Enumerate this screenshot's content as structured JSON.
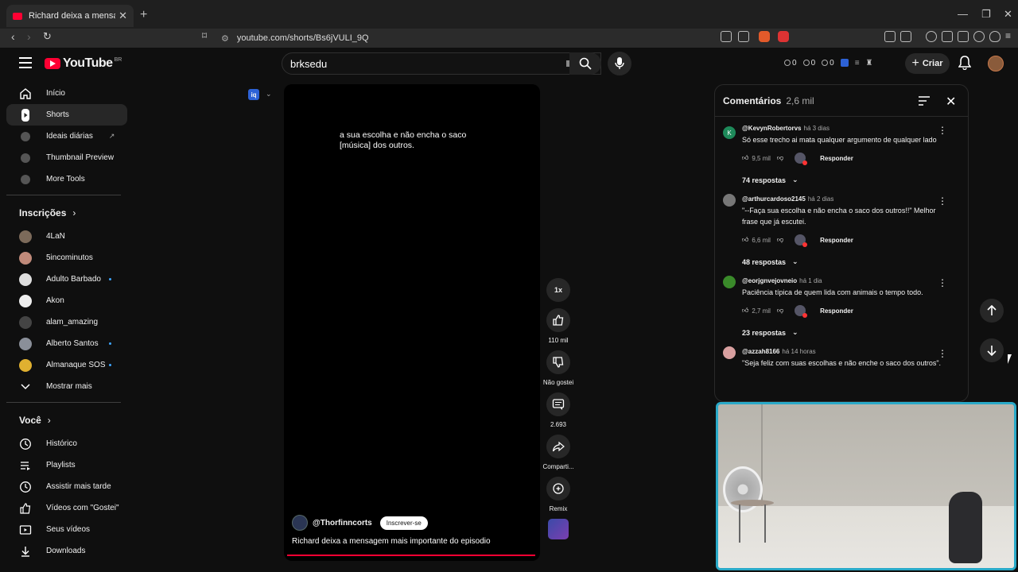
{
  "browser": {
    "tab_title": "Richard deixa a mensagem mais",
    "url": "youtube.com/shorts/Bs6jVULI_9Q"
  },
  "masthead": {
    "logo_text": "YouTube",
    "country_code": "BR",
    "search_value": "brksedu",
    "stats": [
      "0",
      "0",
      "0"
    ],
    "create_label": "Criar"
  },
  "sidebar": {
    "main": [
      {
        "label": "Início",
        "icon": "home-icon"
      },
      {
        "label": "Shorts",
        "icon": "shorts-icon"
      },
      {
        "label": "Ideais diárias",
        "icon": "ideas-icon"
      },
      {
        "label": "Thumbnail Preview",
        "icon": "thumbnail-icon"
      },
      {
        "label": "More Tools",
        "icon": "tools-icon"
      }
    ],
    "subscriptions_header": "Inscrições",
    "subscriptions": [
      {
        "label": "4LaN",
        "color": "#7c6a5a"
      },
      {
        "label": "5incominutos",
        "color": "#c08a7a"
      },
      {
        "label": "Adulto Barbado",
        "color": "#dddddd"
      },
      {
        "label": "Akon",
        "color": "#eeeeee"
      },
      {
        "label": "alam_amazing",
        "color": "#2a2a2a"
      },
      {
        "label": "Alberto Santos",
        "color": "#8a8f99"
      },
      {
        "label": "Almanaque SOS",
        "color": "#e0b030"
      }
    ],
    "show_more": "Mostrar mais",
    "you_header": "Você",
    "you_items": [
      {
        "label": "Histórico",
        "icon": "history-icon"
      },
      {
        "label": "Playlists",
        "icon": "playlists-icon"
      },
      {
        "label": "Assistir mais tarde",
        "icon": "watch-later-icon"
      },
      {
        "label": "Vídeos com \"Gostei\"",
        "icon": "like-icon"
      },
      {
        "label": "Seus vídeos",
        "icon": "your-videos-icon"
      },
      {
        "label": "Downloads",
        "icon": "download-icon"
      }
    ]
  },
  "player": {
    "caption_line1": "a sua escolha e não encha o saco",
    "caption_line2": "[música] dos outros.",
    "channel": "@Thorfinncorts",
    "subscribe_label": "Inscrever-se",
    "title": "Richard deixa a mensagem mais importante do episodio",
    "progress_percent": 100
  },
  "actions": {
    "speed": "1x",
    "likes": "110 mil",
    "dislike": "Não gostei",
    "comments": "2.693",
    "share": "Comparti...",
    "remix": "Remix"
  },
  "comments": {
    "title": "Comentários",
    "count": "2,6 mil",
    "reply_label": "Responder",
    "items": [
      {
        "user": "@KevynRobertorvs",
        "time": "há 3 dias",
        "text": "Só esse trecho ai mata qualquer argumento de qualquer lado",
        "likes": "9,5 mil",
        "replies": "74 respostas",
        "avatar_letter": "K",
        "avatar_color": "#1e8a5a"
      },
      {
        "user": "@arthurcardoso2145",
        "time": "há 2 dias",
        "text": "\"--Faça sua escolha e não encha o saco dos outros!!\" Melhor frase que já escutei.",
        "likes": "6,6 mil",
        "replies": "48 respostas",
        "avatar_letter": "",
        "avatar_color": "#777777"
      },
      {
        "user": "@eorjgnvejovneio",
        "time": "há 1 dia",
        "text": "Paciência típica de quem lida com animais o tempo todo.",
        "likes": "2,7 mil",
        "replies": "23 respostas",
        "avatar_letter": "",
        "avatar_color": "#3a8a2a"
      },
      {
        "user": "@azzah8166",
        "time": "há 14 horas",
        "text": "\"Seja feliz com suas escolhas e não enche o saco dos outros\".",
        "likes": "",
        "replies": "",
        "avatar_letter": "",
        "avatar_color": "#d9a0a0"
      }
    ]
  }
}
